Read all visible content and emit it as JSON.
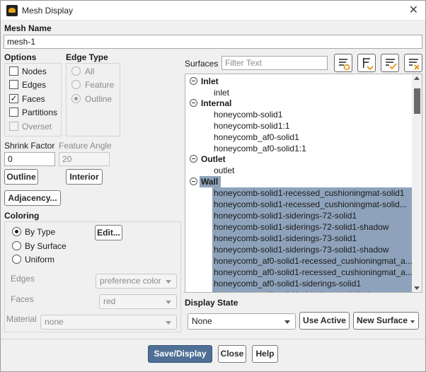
{
  "window": {
    "title": "Mesh Display"
  },
  "mesh_name": {
    "label": "Mesh Name",
    "value": "mesh-1"
  },
  "options": {
    "label": "Options",
    "items": [
      {
        "label": "Nodes",
        "checked": false,
        "disabled": false
      },
      {
        "label": "Edges",
        "checked": false,
        "disabled": false
      },
      {
        "label": "Faces",
        "checked": true,
        "disabled": false
      },
      {
        "label": "Partitions",
        "checked": false,
        "disabled": false
      },
      {
        "label": "Overset",
        "checked": false,
        "disabled": true
      }
    ]
  },
  "edge_type": {
    "label": "Edge Type",
    "items": [
      {
        "label": "All",
        "selected": false
      },
      {
        "label": "Feature",
        "selected": false
      },
      {
        "label": "Outline",
        "selected": true
      }
    ],
    "disabled": true
  },
  "shrink_factor": {
    "label": "Shrink Factor",
    "value": "0"
  },
  "feature_angle": {
    "label": "Feature Angle",
    "value": "20"
  },
  "buttons": {
    "outline": "Outline",
    "interior": "Interior",
    "adjacency": "Adjacency...",
    "edit": "Edit...",
    "use_active": "Use Active",
    "new_surface": "New Surface",
    "save_display": "Save/Display",
    "close": "Close",
    "help": "Help"
  },
  "coloring": {
    "label": "Coloring",
    "modes": [
      {
        "label": "By Type",
        "selected": true
      },
      {
        "label": "By Surface",
        "selected": false
      },
      {
        "label": "Uniform",
        "selected": false
      }
    ],
    "edges": {
      "label": "Edges",
      "value": "preference color"
    },
    "faces": {
      "label": "Faces",
      "value": "red"
    },
    "material": {
      "label": "Material",
      "value": "none"
    }
  },
  "surfaces": {
    "label": "Surfaces",
    "filter_placeholder": "Filter Text",
    "groups": [
      {
        "name": "Inlet",
        "selected": false,
        "items": [
          "inlet"
        ]
      },
      {
        "name": "Internal",
        "selected": false,
        "items": [
          "honeycomb-solid1",
          "honeycomb-solid1:1",
          "honeycomb_af0-solid1",
          "honeycomb_af0-solid1:1"
        ]
      },
      {
        "name": "Outlet",
        "selected": false,
        "items": [
          "outlet"
        ]
      },
      {
        "name": "Wall",
        "selected": true,
        "items": [
          "honeycomb-solid1-recessed_cushioningmat-solid1",
          "honeycomb-solid1-recessed_cushioningmat-solid...",
          "honeycomb-solid1-siderings-72-solid1",
          "honeycomb-solid1-siderings-72-solid1-shadow",
          "honeycomb-solid1-siderings-73-solid1",
          "honeycomb-solid1-siderings-73-solid1-shadow",
          "honeycomb_af0-solid1-recessed_cushioningmat_a...",
          "honeycomb_af0-solid1-recessed_cushioningmat_a...",
          "honeycomb_af0-solid1-siderings-solid1",
          "honeycomb_af0-solid1-siderings-solid1-shadow"
        ]
      }
    ],
    "toolbar_icons": [
      "select-all-icon",
      "deselect-group-icon",
      "select-all-check-icon",
      "deselect-all-icon"
    ]
  },
  "display_state": {
    "label": "Display State",
    "value": "None"
  },
  "colors": {
    "selection": "#8ea3bb",
    "primary_button": "#4f6f96"
  }
}
